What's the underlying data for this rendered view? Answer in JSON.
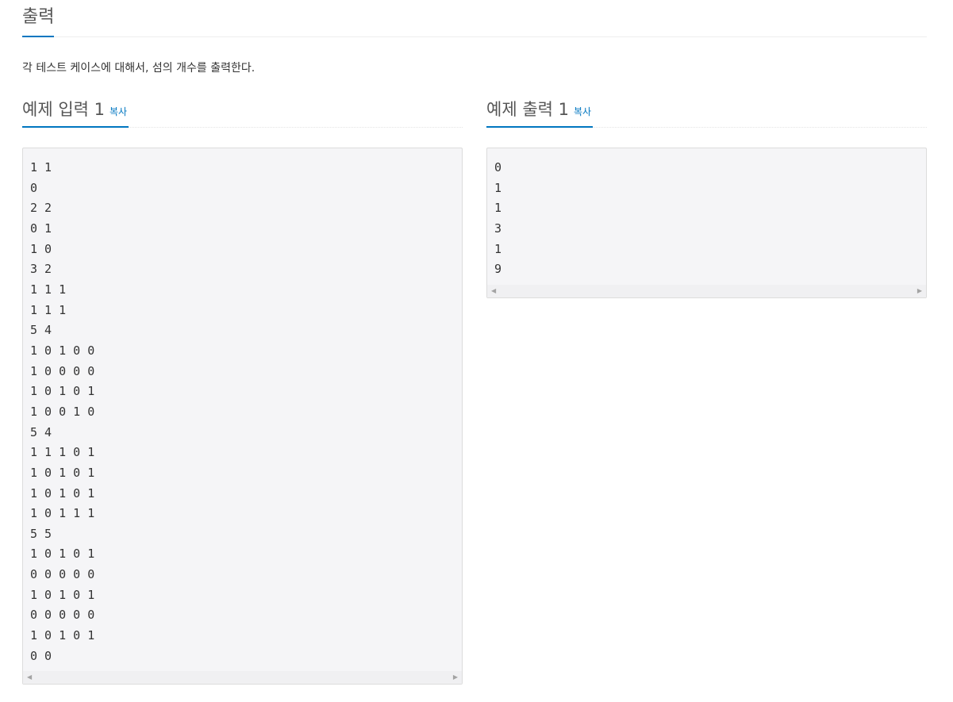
{
  "output_section": {
    "title": "출력",
    "description": "각 테스트 케이스에 대해서, 섬의 개수를 출력한다."
  },
  "sample_input": {
    "title": "예제 입력 1",
    "copy_label": "복사",
    "content": "1 1\n0\n2 2\n0 1\n1 0\n3 2\n1 1 1\n1 1 1\n5 4\n1 0 1 0 0\n1 0 0 0 0\n1 0 1 0 1\n1 0 0 1 0\n5 4\n1 1 1 0 1\n1 0 1 0 1\n1 0 1 0 1\n1 0 1 1 1\n5 5\n1 0 1 0 1\n0 0 0 0 0\n1 0 1 0 1\n0 0 0 0 0\n1 0 1 0 1\n0 0"
  },
  "sample_output": {
    "title": "예제 출력 1",
    "copy_label": "복사",
    "content": "0\n1\n1\n3\n1\n9"
  },
  "scrollbar": {
    "left_arrow": "◀",
    "right_arrow": "▶"
  },
  "colors": {
    "accent": "#0076c0",
    "pre_background": "#f5f5f7",
    "pre_border": "#dcdcdc"
  }
}
